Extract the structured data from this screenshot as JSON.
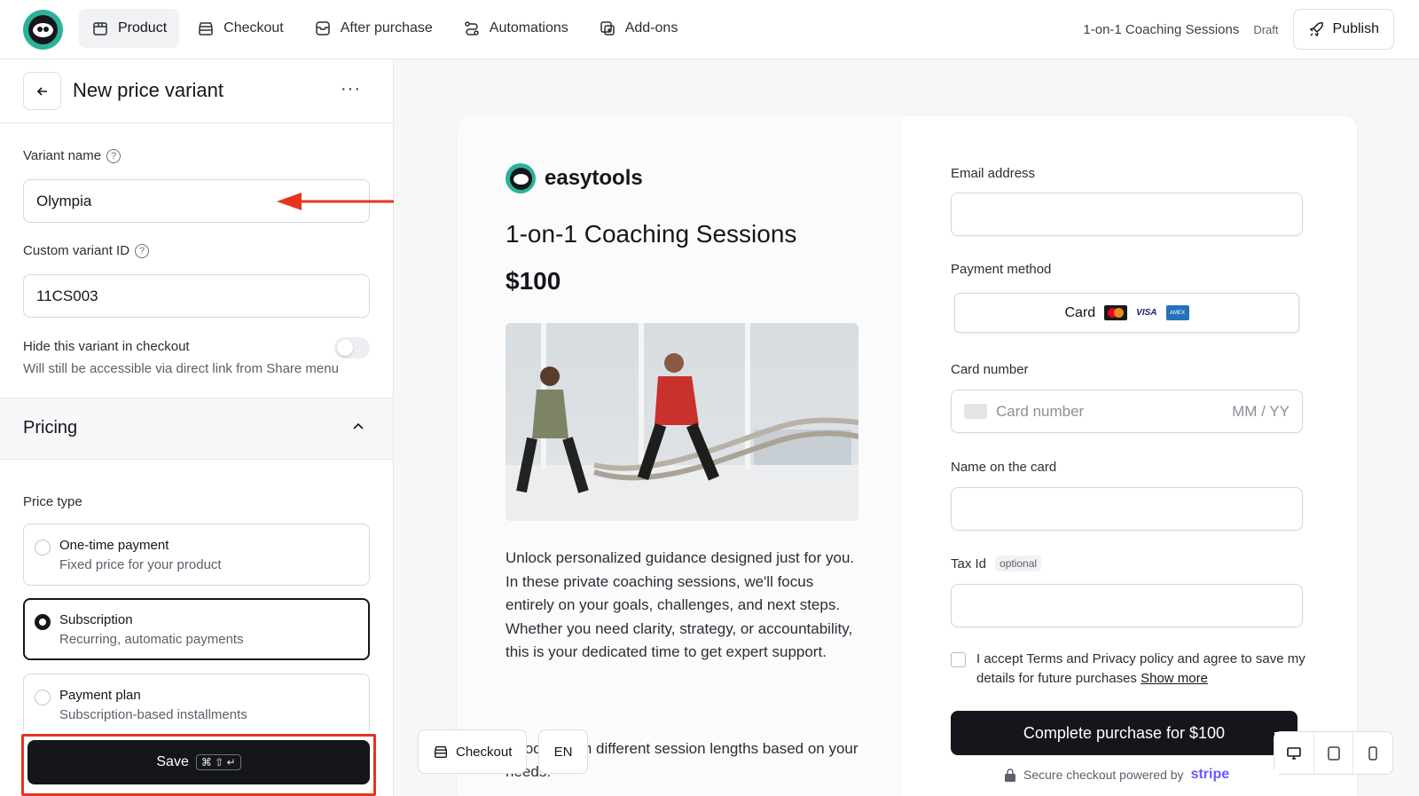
{
  "nav": {
    "items": [
      {
        "label": "Product",
        "icon": "box-icon",
        "active": true
      },
      {
        "label": "Checkout",
        "icon": "store-icon",
        "active": false
      },
      {
        "label": "After purchase",
        "icon": "package-icon",
        "active": false
      },
      {
        "label": "Automations",
        "icon": "route-icon",
        "active": false
      },
      {
        "label": "Add-ons",
        "icon": "plus-square-icon",
        "active": false
      }
    ],
    "product_name": "1-on-1 Coaching Sessions",
    "status": "Draft",
    "publish_label": "Publish"
  },
  "sidebar": {
    "title": "New price variant",
    "more": "···",
    "variant_name_label": "Variant name",
    "variant_name_value": "Olympia",
    "custom_id_label": "Custom variant ID",
    "custom_id_value": "11CS003",
    "hide_label": "Hide this variant in checkout",
    "hide_sub": "Will still be accessible via direct link from Share menu",
    "hide_toggle_on": false,
    "pricing_title": "Pricing",
    "price_type_label": "Price type",
    "price_options": [
      {
        "title": "One-time payment",
        "sub": "Fixed price for your product",
        "selected": false
      },
      {
        "title": "Subscription",
        "sub": "Recurring, automatic payments",
        "selected": true
      },
      {
        "title": "Payment plan",
        "sub": "Subscription-based installments",
        "selected": false
      }
    ],
    "save_label": "Save",
    "save_shortcut": "⌘ ⇧ ↵"
  },
  "preview": {
    "brand": "easytools",
    "product_title": "1-on-1 Coaching Sessions",
    "price": "$100",
    "description": "Unlock personalized guidance designed just for you. In these private coaching sessions, we'll focus entirely on your goals, challenges, and next steps. Whether you need clarity, strategy, or accountability, this is your dedicated time to get expert support.",
    "description2": "Choose from different session lengths based on your needs:",
    "email_label": "Email address",
    "payment_method_label": "Payment method",
    "payment_method_value": "Card",
    "visa": "VISA",
    "amex": "AMEX",
    "card_number_label": "Card number",
    "card_number_placeholder": "Card number",
    "expiry_placeholder": "MM / YY",
    "name_label": "Name on the card",
    "tax_label": "Tax Id",
    "tax_optional": "optional",
    "accept_text": "I accept Terms and Privacy policy and agree to save my details for future purchases",
    "show_more": "Show more",
    "complete_label": "Complete purchase for $100",
    "secure_text": "Secure checkout powered by",
    "stripe": "stripe"
  },
  "floating": {
    "checkout_label": "Checkout",
    "lang": "EN"
  },
  "colors": {
    "accent": "#2bb39a",
    "dark": "#14161c",
    "highlight": "#e53420"
  }
}
